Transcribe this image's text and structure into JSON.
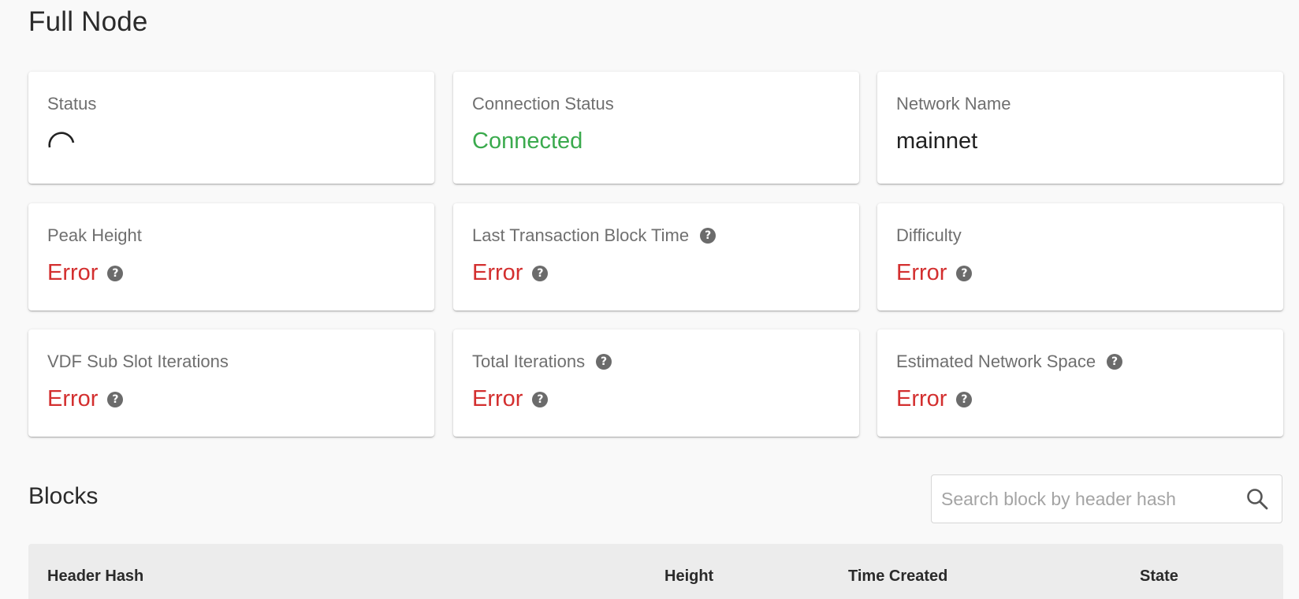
{
  "page": {
    "title": "Full Node"
  },
  "cards": {
    "status": {
      "title": "Status"
    },
    "connection_status": {
      "title": "Connection Status",
      "value": "Connected"
    },
    "network_name": {
      "title": "Network Name",
      "value": "mainnet"
    },
    "peak_height": {
      "title": "Peak Height",
      "value": "Error"
    },
    "last_tx_block_time": {
      "title": "Last Transaction Block Time",
      "value": "Error"
    },
    "difficulty": {
      "title": "Difficulty",
      "value": "Error"
    },
    "vdf_sub_slot_iterations": {
      "title": "VDF Sub Slot Iterations",
      "value": "Error"
    },
    "total_iterations": {
      "title": "Total Iterations",
      "value": "Error"
    },
    "estimated_network_space": {
      "title": "Estimated Network Space",
      "value": "Error"
    }
  },
  "help_icon": {
    "glyph": "?",
    "icon": "help-circle-icon"
  },
  "blocks": {
    "title": "Blocks",
    "search": {
      "placeholder": "Search block by header hash",
      "value": ""
    },
    "columns": [
      "Header Hash",
      "Height",
      "Time Created",
      "State"
    ]
  },
  "colors": {
    "error": "#d32f2f",
    "connected": "#3aaa4d",
    "background": "#f9f9f9"
  }
}
